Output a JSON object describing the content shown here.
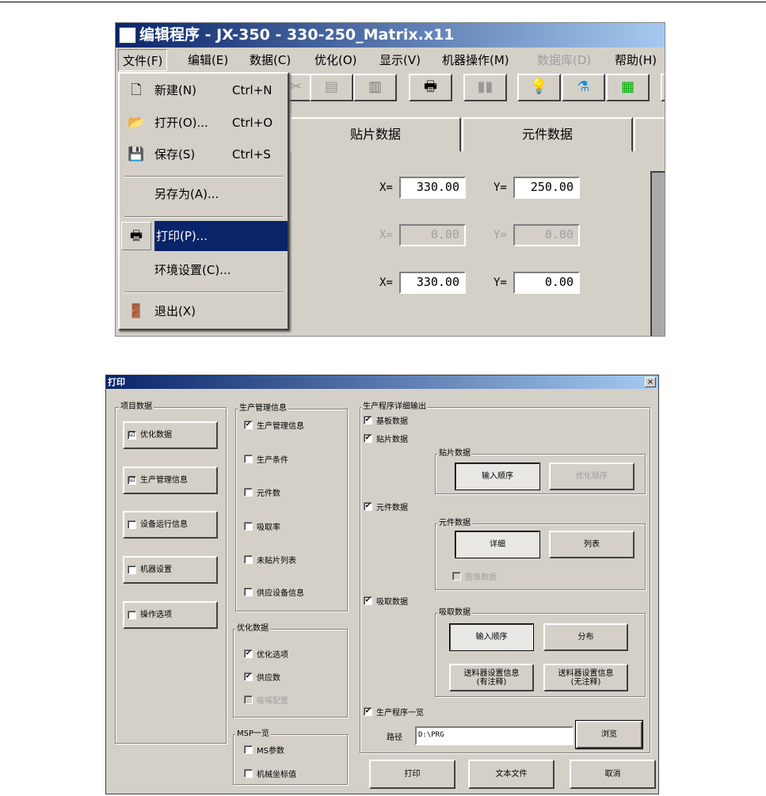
{
  "editor_window": {
    "title": "编辑程序 - JX-350 - 330-250_Matrix.x11",
    "menu": [
      "文件(F)",
      "编辑(E)",
      "数据(C)",
      "优化(O)",
      "显示(V)",
      "机器操作(M)",
      "数据库(D)",
      "帮助(H)"
    ],
    "tabs": [
      "贴片数据",
      "元件数据"
    ],
    "file_menu": [
      {
        "label": "新建(N)",
        "shortcut": "Ctrl+N",
        "icon": "new-file-icon"
      },
      {
        "label": "打开(O)...",
        "shortcut": "Ctrl+O",
        "icon": "open-folder-icon"
      },
      {
        "label": "保存(S)",
        "shortcut": "Ctrl+S",
        "icon": "save-icon"
      },
      {
        "label": "另存为(A)..."
      },
      {
        "label": "打印(P)...",
        "icon": "printer-icon",
        "highlighted": true
      },
      {
        "label": "环境设置(C)..."
      },
      {
        "label": "退出(X)",
        "icon": "exit-door-icon"
      }
    ],
    "coords": [
      {
        "x_label": "X=",
        "x": "330.00",
        "y_label": "Y=",
        "y": "250.00",
        "disabled": false
      },
      {
        "x_label": "X=",
        "x": "0.00",
        "y_label": "Y=",
        "y": "0.00",
        "disabled": true
      },
      {
        "x_label": "X=",
        "x": "330.00",
        "y_label": "Y=",
        "y": "0.00",
        "disabled": false
      }
    ],
    "highlight_color": "#0a246a"
  },
  "print_dialog": {
    "title": "打印",
    "close": "×",
    "project_data": {
      "label": "项目数据",
      "items": [
        {
          "label": "优化数据",
          "checked": "☑"
        },
        {
          "label": "生产管理信息",
          "checked": "☑"
        },
        {
          "label": "设备运行信息",
          "checked": ""
        },
        {
          "label": "机器设置",
          "checked": ""
        },
        {
          "label": "操作选项",
          "checked": ""
        }
      ]
    },
    "production_info": {
      "label": "生产管理信息",
      "items": [
        {
          "label": "生产管理信息",
          "checked": "✔"
        },
        {
          "label": "生产条件",
          "checked": ""
        },
        {
          "label": "元件数",
          "checked": ""
        },
        {
          "label": "吸取率",
          "checked": ""
        },
        {
          "label": "未贴片列表",
          "checked": ""
        },
        {
          "label": "供应设备信息",
          "checked": ""
        }
      ]
    },
    "optimize_data": {
      "label": "优化数据",
      "items": [
        {
          "label": "优化选项",
          "checked": "✔"
        },
        {
          "label": "供应数",
          "checked": "✔"
        },
        {
          "label": "吸嘴配置",
          "checked": ""
        }
      ]
    },
    "msp": {
      "label": "MSP一览",
      "items": [
        {
          "label": "MS参数",
          "checked": ""
        },
        {
          "label": "机械坐标值",
          "checked": ""
        }
      ]
    },
    "detail": {
      "label": "生产程序详细输出",
      "board": {
        "label": "基板数据",
        "checked": "✔"
      },
      "placement": {
        "label": "贴片数据",
        "checked": "✔",
        "group": "贴片数据",
        "btn1": "输入顺序",
        "btn2": "优化顺序"
      },
      "component": {
        "label": "元件数据",
        "checked": "✔",
        "group": "元件数据",
        "btn1": "详细",
        "btn2": "列表",
        "image": "图像数据"
      },
      "pickup": {
        "label": "吸取数据",
        "checked": "✔",
        "group": "吸取数据",
        "btn1": "输入顺序",
        "btn2": "分布",
        "btn3a": "送料器设置信息",
        "btn3b": "(有注释)",
        "btn4a": "送料器设置信息",
        "btn4b": "(无注释)"
      },
      "list": {
        "label": "生产程序一览",
        "checked": "✔"
      },
      "path_label": "路径",
      "path": "D:\\PRG",
      "browse": "浏览"
    },
    "buttons": {
      "print": "打印",
      "text_file": "文本文件",
      "cancel": "取消"
    }
  }
}
